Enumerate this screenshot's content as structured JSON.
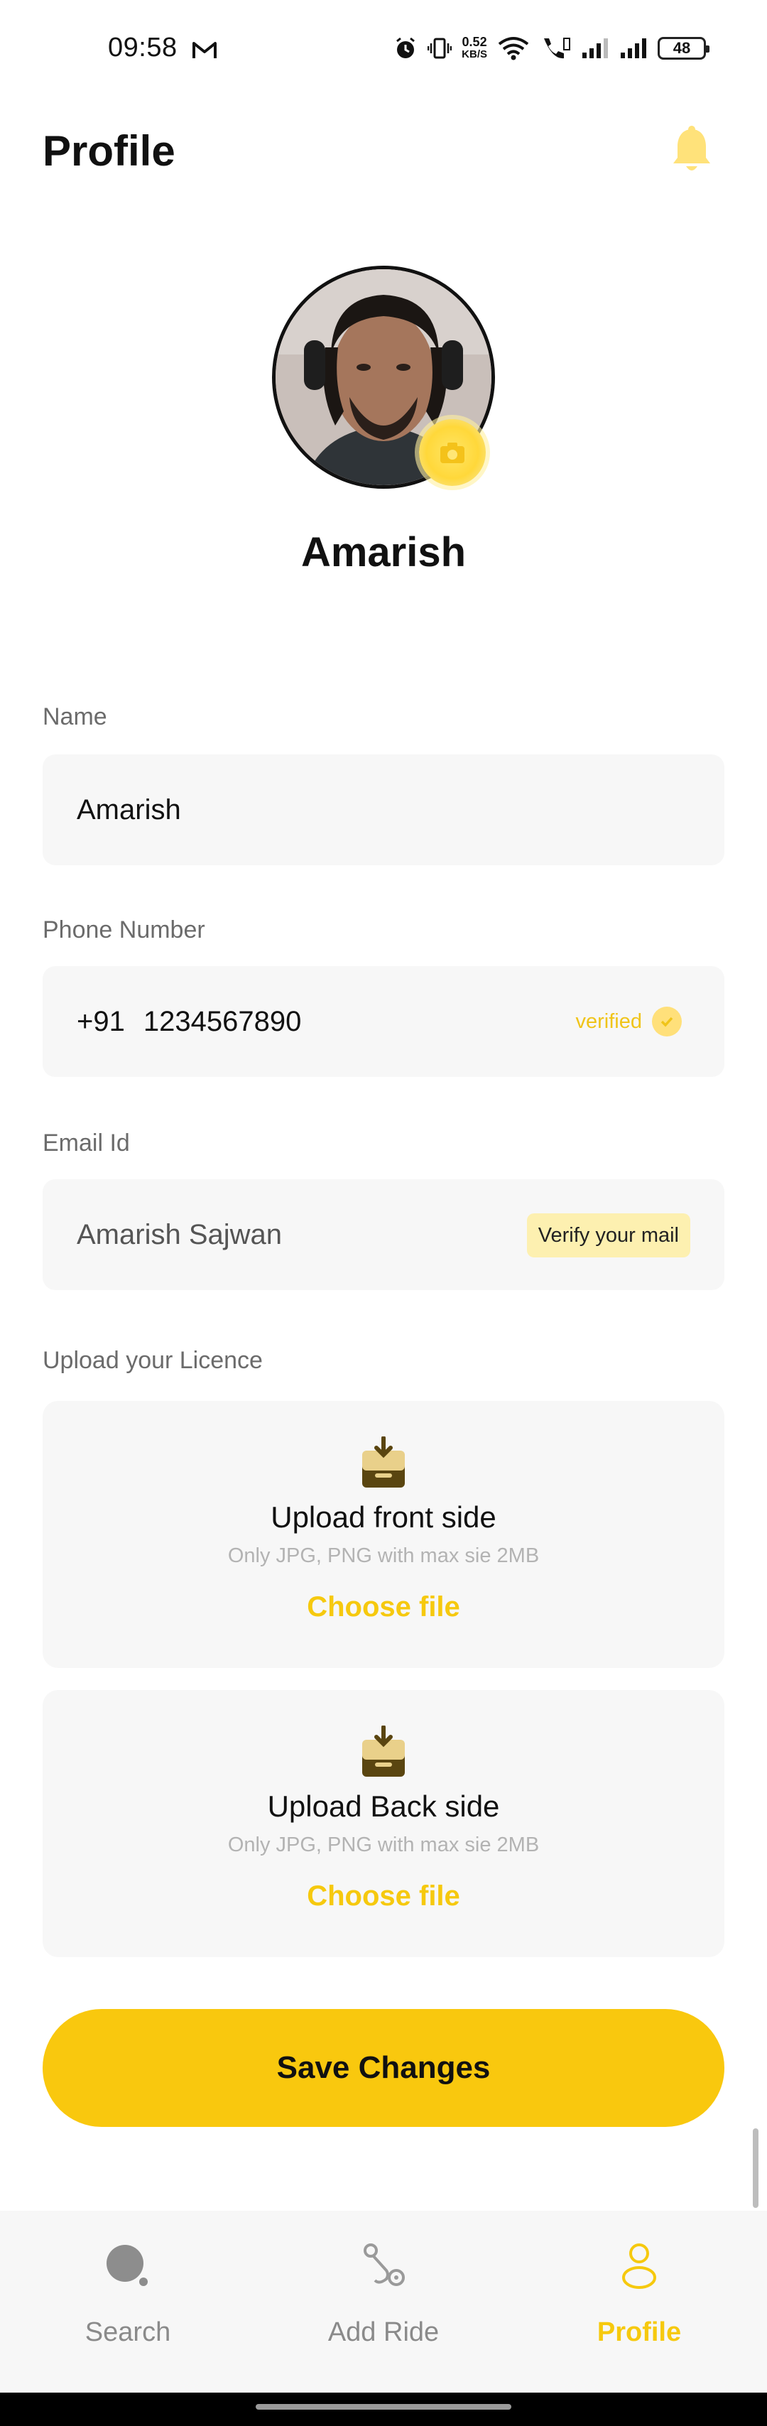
{
  "status_bar": {
    "time": "09:58",
    "net_speed_value": "0.52",
    "net_speed_unit": "KB/S",
    "battery": "48"
  },
  "header": {
    "title": "Profile",
    "bell_icon": "bell-icon"
  },
  "profile": {
    "name": "Amarish",
    "avatar_icon": "avatar-photo",
    "camera_icon": "camera-icon"
  },
  "form": {
    "name_label": "Name",
    "name_value": "Amarish",
    "phone_label": "Phone Number",
    "phone_code": "+91",
    "phone_value": "1234567890",
    "phone_status": "verified",
    "email_label": "Email Id",
    "email_value": "Amarish Sajwan",
    "email_action": "Verify your mail",
    "licence_label": "Upload your Licence"
  },
  "uploads": [
    {
      "title": "Upload front side",
      "hint": "Only JPG, PNG with max sie 2MB",
      "action": "Choose file"
    },
    {
      "title": "Upload Back side",
      "hint": "Only JPG, PNG with max sie 2MB",
      "action": "Choose file"
    }
  ],
  "save_label": "Save Changes",
  "nav": [
    {
      "label": "Search",
      "icon": "search-icon",
      "active": false
    },
    {
      "label": "Add Ride",
      "icon": "route-icon",
      "active": false
    },
    {
      "label": "Profile",
      "icon": "profile-icon",
      "active": true
    }
  ],
  "colors": {
    "accent": "#F9C80E",
    "field_bg": "#F7F7F7",
    "label": "#6B6B6B"
  }
}
